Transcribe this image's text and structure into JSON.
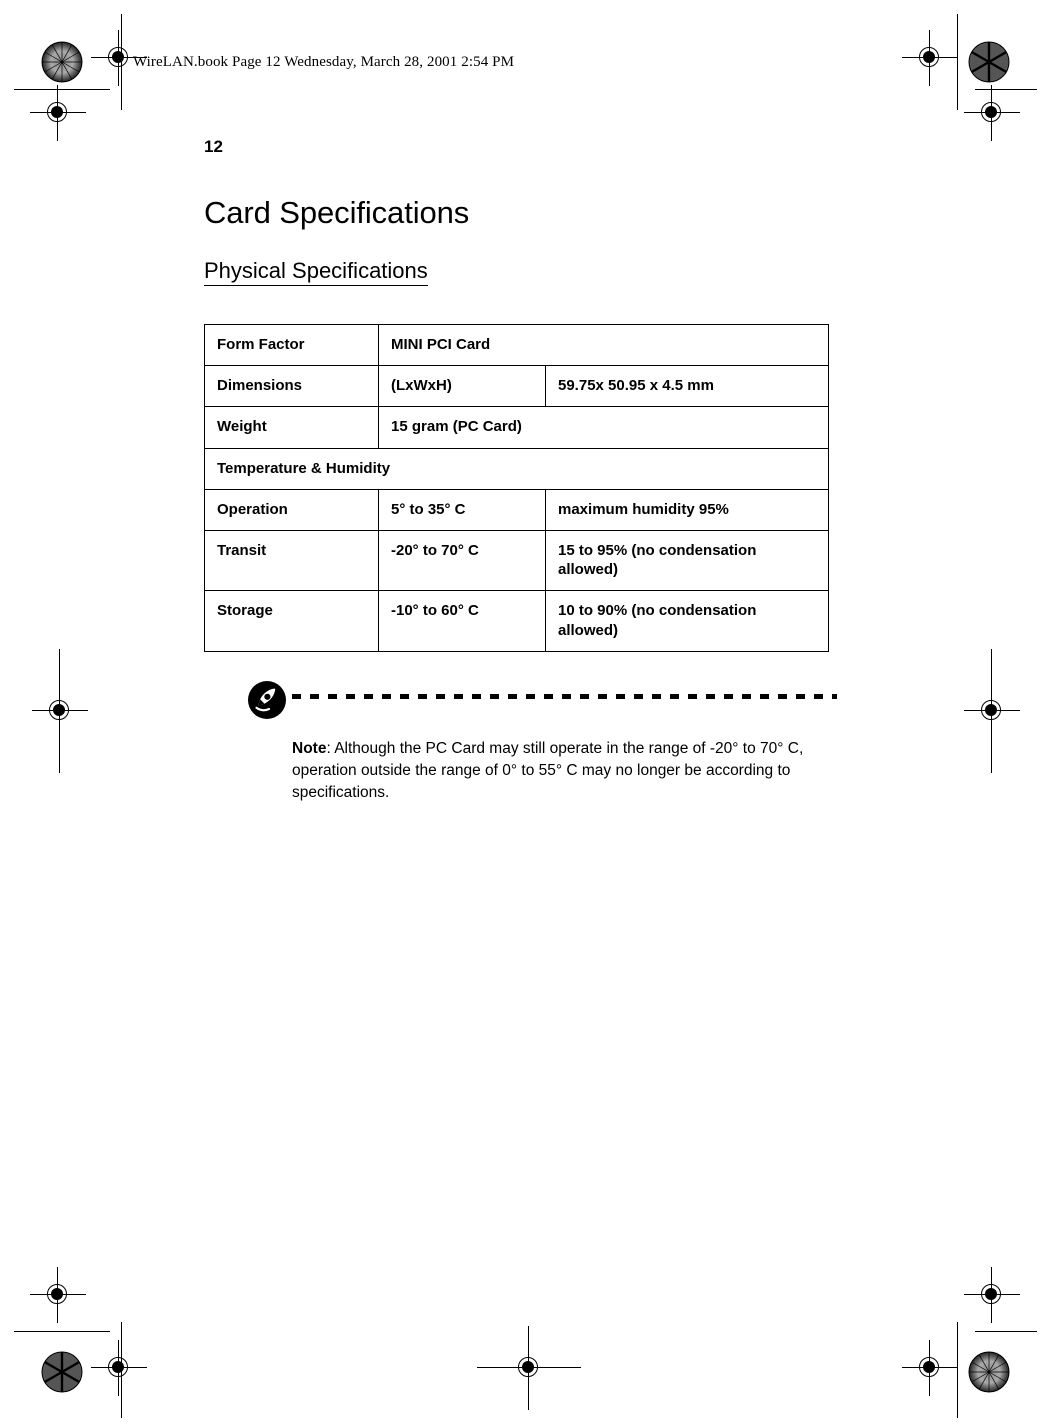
{
  "page": {
    "header_line": "WireLAN.book  Page 12  Wednesday, March 28, 2001  2:54 PM",
    "folio": "12",
    "chapter_title": "Card Specifications",
    "section_title": "Physical Specifications"
  },
  "spec_table": {
    "rows": [
      {
        "label": "Form Factor",
        "middle": "MINI PCI Card",
        "right": "",
        "span": 2
      },
      {
        "label": "Dimensions",
        "middle": "(LxWxH)",
        "right": "59.75x 50.95 x 4.5 mm",
        "span": 1
      },
      {
        "label": "Weight",
        "middle": "15 gram (PC Card)",
        "right": "",
        "span": 2
      },
      {
        "label": "Temperature & Humidity",
        "middle": "",
        "right": "",
        "span": 3
      },
      {
        "label": "Operation",
        "middle": "5° to 35° C",
        "right": "maximum humidity 95%",
        "span": 1
      },
      {
        "label": "Transit",
        "middle": "-20° to 70° C",
        "right": "15 to 95% (no condensation allowed)",
        "span": 1
      },
      {
        "label": "Storage",
        "middle": "-10° to 60° C",
        "right": "10 to 90% (no condensation allowed)",
        "span": 1
      }
    ],
    "cells": {
      "r0c0": "Form Factor",
      "r0c1": "MINI PCI Card",
      "r1c0": "Dimensions",
      "r1c1": "(LxWxH)",
      "r1c2": "59.75x 50.95 x 4.5 mm",
      "r2c0": "Weight",
      "r2c1": "15 gram (PC Card)",
      "r3c0": "Temperature & Humidity",
      "r4c0": "Operation",
      "r4c1": "5° to 35° C",
      "r4c2": "maximum humidity 95%",
      "r5c0": "Transit",
      "r5c1": "-20° to 70° C",
      "r5c2": "15 to 95% (no condensation allowed)",
      "r6c0": "Storage",
      "r6c1": "-10° to 60° C",
      "r6c2": "10 to 90% (no condensation allowed)"
    }
  },
  "note": {
    "icon_name": "acer-note-pen-icon",
    "lead": "Note",
    "body": ": Although the PC Card may still operate in the range of -20° to 70° C, operation outside the range of 0° to 55° C may no longer be according to specifications."
  },
  "colors": {
    "ink": "#000000",
    "paper": "#ffffff"
  }
}
